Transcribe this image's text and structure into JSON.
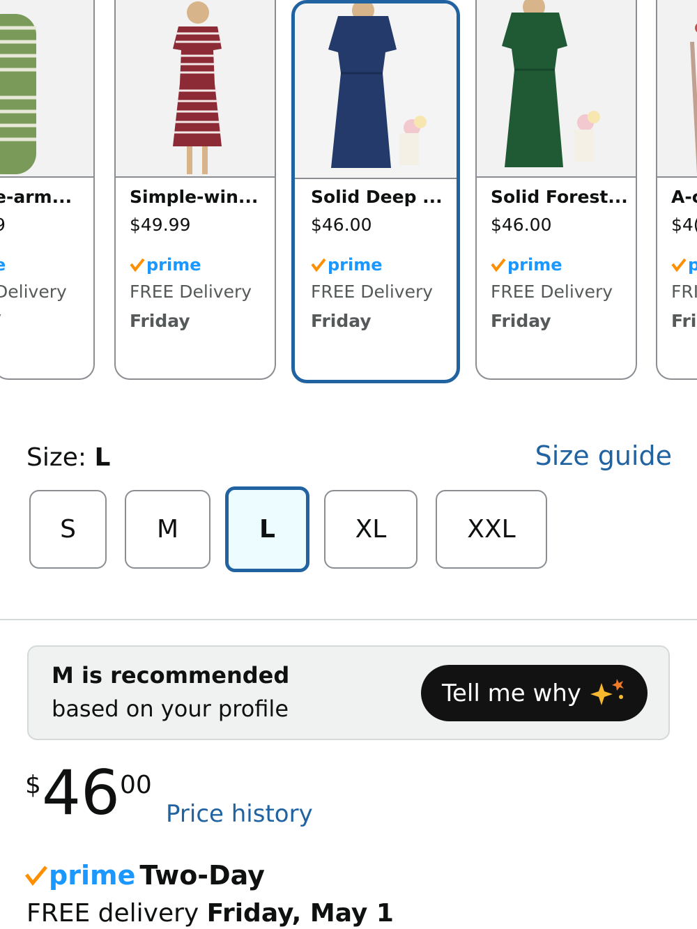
{
  "carousel": {
    "items": [
      {
        "title": "e-arm...",
        "price": "9",
        "prime": "e",
        "delivery": "Delivery",
        "day": "/"
      },
      {
        "title": "Simple-win...",
        "price": "$49.99",
        "prime": "prime",
        "delivery": "FREE Delivery",
        "day": "Friday"
      },
      {
        "title": "Solid Deep ...",
        "price": "$46.00",
        "prime": "prime",
        "delivery": "FREE Delivery",
        "day": "Friday"
      },
      {
        "title": "Solid Forest...",
        "price": "$46.00",
        "prime": "prime",
        "delivery": "FREE Delivery",
        "day": "Friday"
      },
      {
        "title": "A-c",
        "price": "$4(",
        "prime": "p",
        "delivery": "FRI",
        "day": "Fri"
      }
    ],
    "dress_colors": [
      "#7a9a5a",
      "#8c2a36",
      "#233a6b",
      "#1f5a34",
      "#c0a090"
    ]
  },
  "size": {
    "label": "Size: ",
    "selected": "L",
    "guide": "Size guide",
    "options": [
      "S",
      "M",
      "L",
      "XL",
      "XXL"
    ]
  },
  "recommendation": {
    "title": "M is recommended",
    "subtitle": "based on your profile",
    "button": "Tell me why"
  },
  "price": {
    "symbol": "$",
    "whole": "46",
    "fraction": "00",
    "history": "Price history"
  },
  "delivery": {
    "prime": "prime",
    "speed": "Two-Day",
    "free_text": "FREE delivery ",
    "date": "Friday, May 1"
  },
  "colors": {
    "accent_blue": "#2162a1",
    "prime_blue": "#1a98ff",
    "prime_check": "#ff8f00",
    "selected_bg": "#edfdff"
  }
}
